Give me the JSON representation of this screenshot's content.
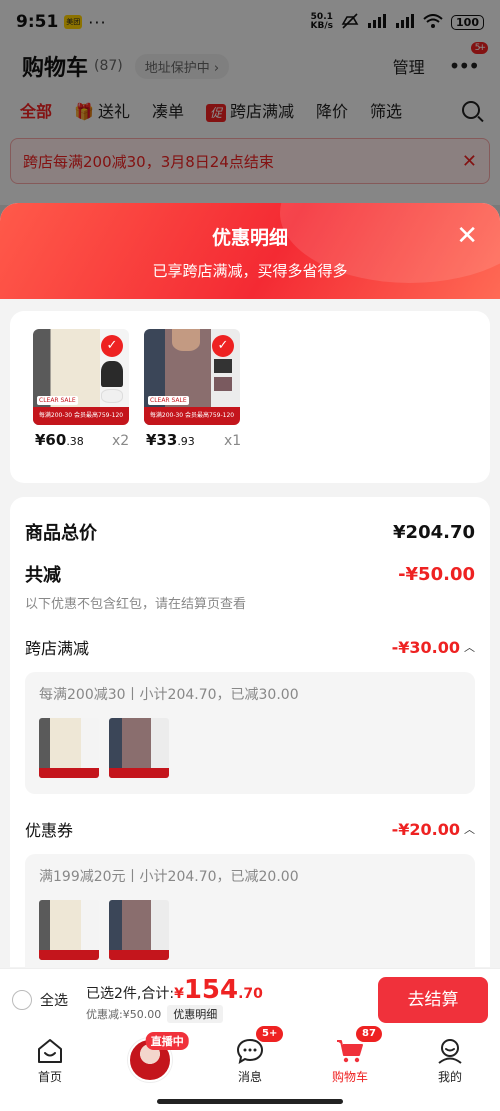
{
  "status_bar": {
    "time": "9:51",
    "app_badge": "美团",
    "dots": "···",
    "speed_top": "50.1",
    "speed_bottom": "KB/s",
    "battery": "100"
  },
  "cart_header": {
    "title": "购物车",
    "count": "(87)",
    "address_pill": "地址保护中 ›",
    "manage": "管理",
    "more_badge": "5+"
  },
  "filter_tabs": [
    {
      "label": "全部",
      "active": true
    },
    {
      "label": "送礼",
      "active": false
    },
    {
      "label": "凑单",
      "active": false
    },
    {
      "label": "跨店满减",
      "active": false,
      "icon": "促"
    },
    {
      "label": "降价",
      "active": false
    },
    {
      "label": "筛选",
      "active": false
    }
  ],
  "promo_banner": {
    "text": "跨店每满200减30，3月8日24点结束"
  },
  "sheet": {
    "title": "优惠明细",
    "subtitle": "已享跨店满减，买得多省得多"
  },
  "products": [
    {
      "price_int": "¥60",
      "price_dec": ".38",
      "qty": "x2",
      "strip": "每满200-30 会员最高759-120",
      "tag": "CLEAR SALE"
    },
    {
      "price_int": "¥33",
      "price_dec": ".93",
      "qty": "x1",
      "strip": "每满200-30 会员最高759-120",
      "tag": "CLEAR SALE"
    }
  ],
  "summary": {
    "total_label": "商品总价",
    "total_value": "¥204.70",
    "reduce_label": "共减",
    "reduce_value": "-¥50.00",
    "reduce_note": "以下优惠不包含红包，请在结算页查看"
  },
  "sections": [
    {
      "label": "跨店满减",
      "value": "-¥30.00",
      "detail": "每满200减30丨小计204.70，已减30.00"
    },
    {
      "label": "优惠券",
      "value": "-¥20.00",
      "detail": "满199减20元丨小计204.70，已减20.00"
    }
  ],
  "checkout": {
    "select_all": "全选",
    "selected_text": "已选2件,合计:",
    "yen": "¥",
    "amount": "154",
    "amount_dec": ".70",
    "discount_text": "优惠减:¥50.00",
    "detail_button": "优惠明细",
    "button": "去结算"
  },
  "tabbar": {
    "home": "首页",
    "live_tag": "直播中",
    "messages": "消息",
    "messages_badge": "5+",
    "cart": "购物车",
    "cart_badge": "87",
    "me": "我的"
  },
  "colors": {
    "accent": "#f0313b",
    "accent_text": "#e22222"
  }
}
